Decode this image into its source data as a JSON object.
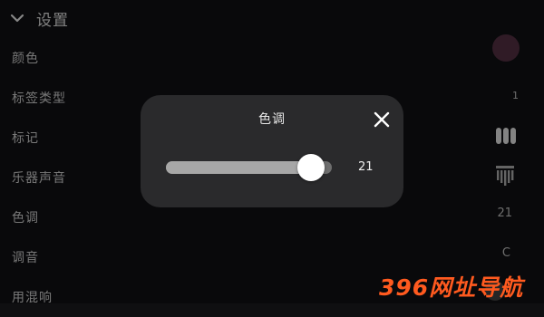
{
  "header": {
    "title": "设置",
    "back_icon": "chevron-down-icon"
  },
  "settings": [
    {
      "label": "颜色",
      "value": "",
      "control": "color-swatch"
    },
    {
      "label": "标签类型",
      "value": "1"
    },
    {
      "label": "标记",
      "value": "",
      "control": "marks-icon"
    },
    {
      "label": "乐器声音",
      "value": "",
      "control": "instrument-icon"
    },
    {
      "label": "色调",
      "value": "21"
    },
    {
      "label": "调音",
      "value": "C"
    },
    {
      "label": "用混响",
      "value": "",
      "control": "toggle"
    }
  ],
  "colors": {
    "swatch": "#4a2a3b",
    "watermark": "#ff5a1f",
    "modal_bg": "#2a2a2c"
  },
  "modal": {
    "title": "色调",
    "close_icon": "close-icon",
    "slider": {
      "value": 21,
      "display": "21",
      "min": 0,
      "max": 24
    }
  },
  "watermark": {
    "text": "396网址导航"
  }
}
